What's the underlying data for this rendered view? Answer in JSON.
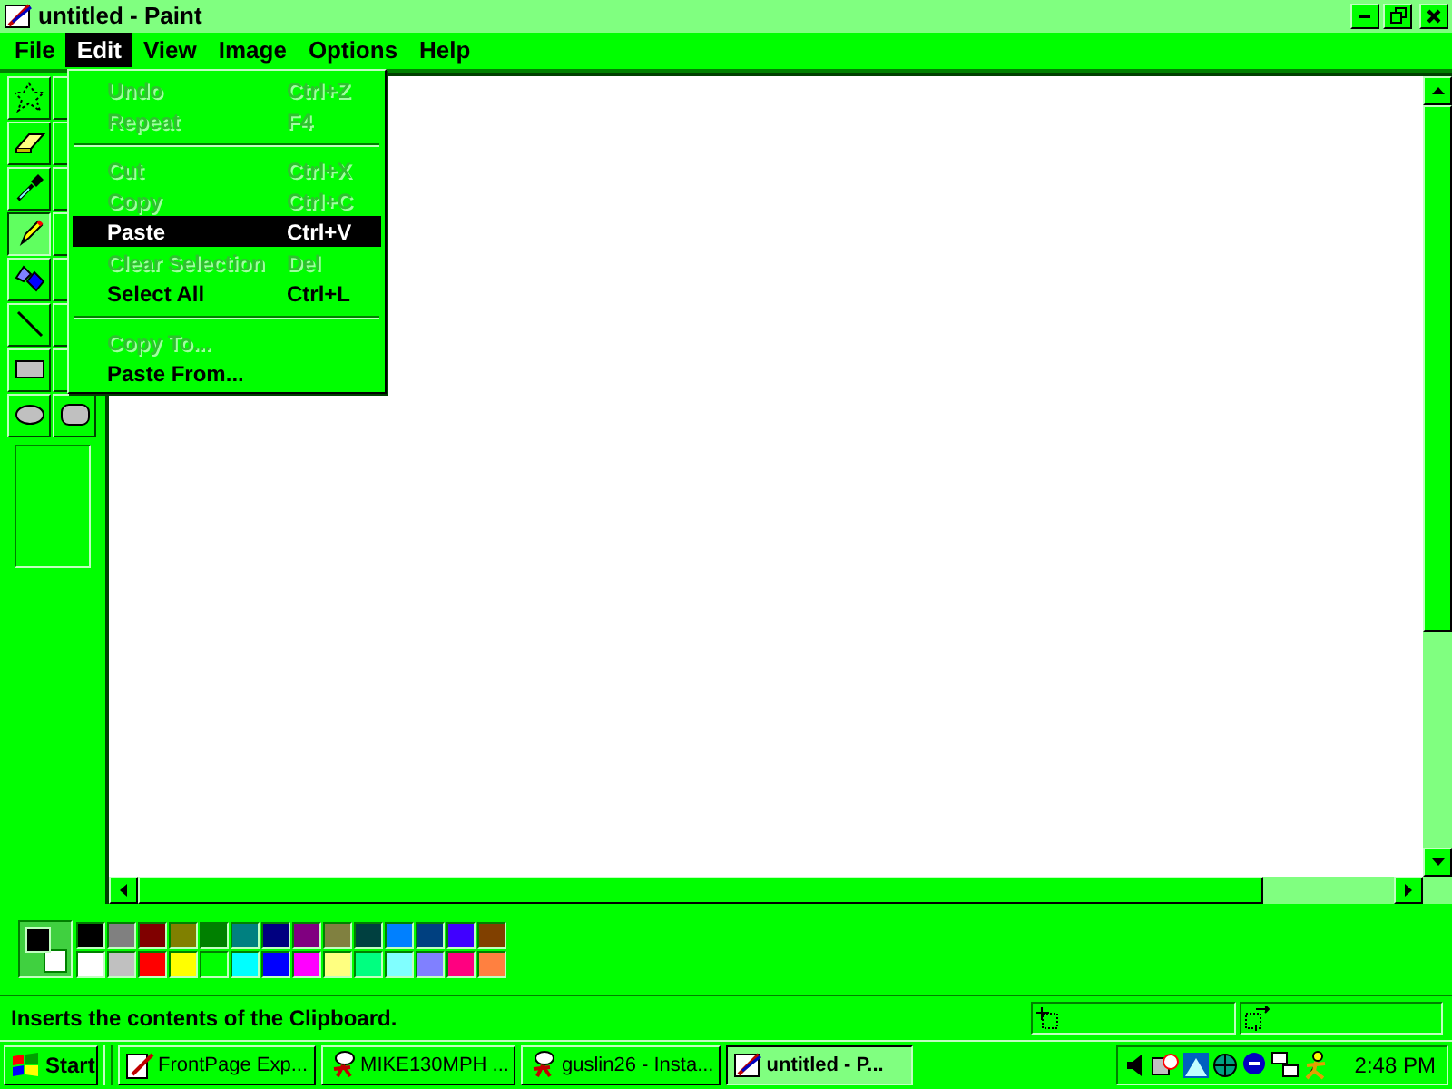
{
  "window": {
    "title": "untitled - Paint"
  },
  "menu_bar": [
    {
      "label": "File",
      "selected": false
    },
    {
      "label": "Edit",
      "selected": true
    },
    {
      "label": "View",
      "selected": false
    },
    {
      "label": "Image",
      "selected": false
    },
    {
      "label": "Options",
      "selected": false
    },
    {
      "label": "Help",
      "selected": false
    }
  ],
  "edit_menu": [
    {
      "kind": "item",
      "label": "Undo",
      "shortcut": "Ctrl+Z",
      "disabled": true,
      "selected": false
    },
    {
      "kind": "item",
      "label": "Repeat",
      "shortcut": "F4",
      "disabled": true,
      "selected": false
    },
    {
      "kind": "separator"
    },
    {
      "kind": "item",
      "label": "Cut",
      "shortcut": "Ctrl+X",
      "disabled": true,
      "selected": false
    },
    {
      "kind": "item",
      "label": "Copy",
      "shortcut": "Ctrl+C",
      "disabled": true,
      "selected": false
    },
    {
      "kind": "item",
      "label": "Paste",
      "shortcut": "Ctrl+V",
      "disabled": false,
      "selected": true
    },
    {
      "kind": "item",
      "label": "Clear Selection",
      "shortcut": "Del",
      "disabled": true,
      "selected": false
    },
    {
      "kind": "item",
      "label": "Select All",
      "shortcut": "Ctrl+L",
      "disabled": false,
      "selected": false
    },
    {
      "kind": "separator"
    },
    {
      "kind": "item",
      "label": "Copy To...",
      "disabled": true,
      "selected": false
    },
    {
      "kind": "item",
      "label": "Paste From...",
      "disabled": false,
      "selected": false
    }
  ],
  "toolbox": [
    {
      "kind": "free-select",
      "selected": false
    },
    {
      "kind": "covered",
      "selected": false
    },
    {
      "kind": "eraser",
      "selected": false
    },
    {
      "kind": "covered",
      "selected": false
    },
    {
      "kind": "eyedropper",
      "selected": false
    },
    {
      "kind": "covered",
      "selected": false
    },
    {
      "kind": "pencil",
      "selected": true
    },
    {
      "kind": "covered",
      "selected": false
    },
    {
      "kind": "fill",
      "selected": false
    },
    {
      "kind": "covered",
      "selected": false
    },
    {
      "kind": "line",
      "selected": false
    },
    {
      "kind": "covered",
      "selected": false
    },
    {
      "kind": "rectangle",
      "selected": false
    },
    {
      "kind": "covered",
      "selected": false
    },
    {
      "kind": "ellipse",
      "selected": false
    },
    {
      "kind": "rounded-rectangle",
      "selected": false
    }
  ],
  "palette": {
    "foreground": {
      "color": "#000000"
    },
    "background": {
      "color": "#ffffff"
    },
    "colors": [
      {
        "color": "#000000"
      },
      {
        "color": "#808080"
      },
      {
        "color": "#800000"
      },
      {
        "color": "#808000"
      },
      {
        "color": "#008000"
      },
      {
        "color": "#008080"
      },
      {
        "color": "#000080"
      },
      {
        "color": "#800080"
      },
      {
        "color": "#808040"
      },
      {
        "color": "#004040"
      },
      {
        "color": "#0080ff"
      },
      {
        "color": "#004080"
      },
      {
        "color": "#4000ff"
      },
      {
        "color": "#804000"
      },
      {
        "color": "#ffffff"
      },
      {
        "color": "#c0c0c0"
      },
      {
        "color": "#ff0000"
      },
      {
        "color": "#ffff00"
      },
      {
        "color": "#00ff00"
      },
      {
        "color": "#00ffff"
      },
      {
        "color": "#0000ff"
      },
      {
        "color": "#ff00ff"
      },
      {
        "color": "#ffff80"
      },
      {
        "color": "#00ff80"
      },
      {
        "color": "#80ffff"
      },
      {
        "color": "#8080ff"
      },
      {
        "color": "#ff0080"
      },
      {
        "color": "#ff8040"
      }
    ]
  },
  "status_bar": {
    "text": "Inserts the contents of the Clipboard."
  },
  "taskbar": {
    "start": "Start",
    "buttons": [
      {
        "label": "FrontPage Exp...",
        "kind": "frontpage",
        "selected": false
      },
      {
        "label": "MIKE130MPH ...",
        "kind": "chat",
        "selected": false
      },
      {
        "label": "guslin26 - Insta...",
        "kind": "chat",
        "selected": false
      },
      {
        "label": "untitled - P...",
        "kind": "paint",
        "selected": true
      }
    ],
    "clock": "2:48 PM"
  }
}
